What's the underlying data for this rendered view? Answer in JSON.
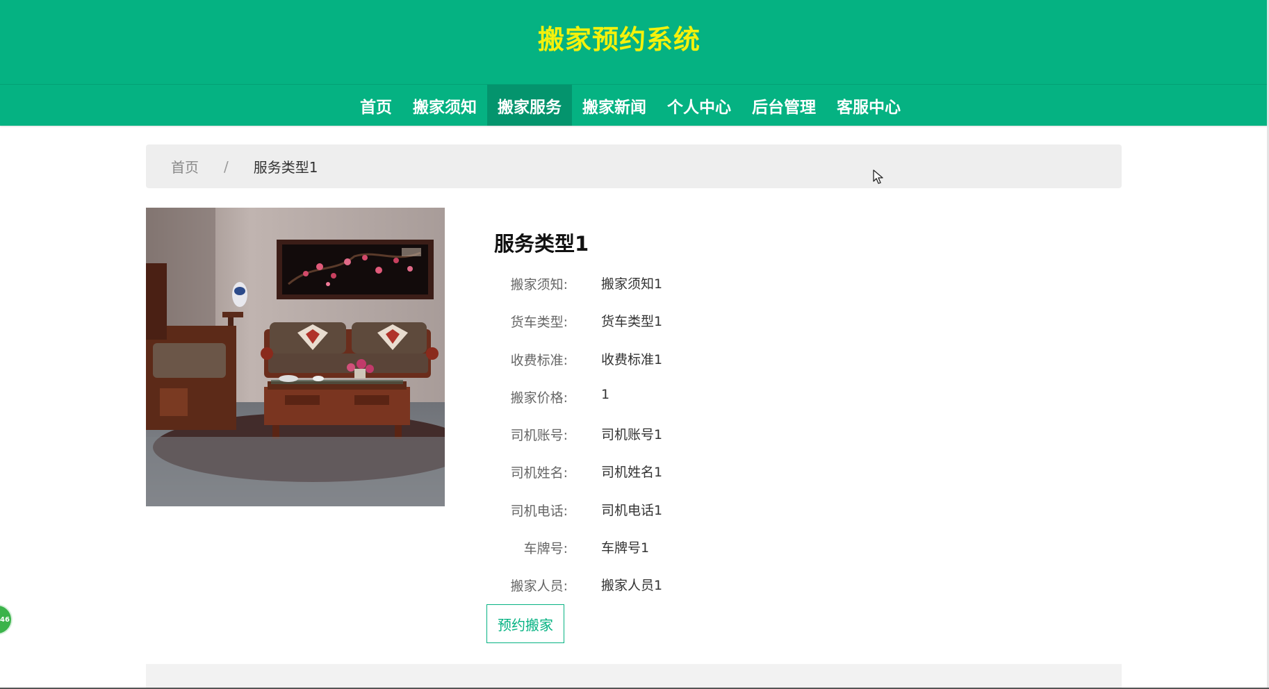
{
  "site": {
    "title": "搬家预约系统"
  },
  "nav": {
    "items": [
      {
        "label": "首页"
      },
      {
        "label": "搬家须知"
      },
      {
        "label": "搬家服务"
      },
      {
        "label": "搬家新闻"
      },
      {
        "label": "个人中心"
      },
      {
        "label": "后台管理"
      },
      {
        "label": "客服中心"
      }
    ],
    "active": "搬家服务"
  },
  "breadcrumb": {
    "home": "首页",
    "separator": "/",
    "current": "服务类型1"
  },
  "detail": {
    "title": "服务类型1",
    "rows": [
      {
        "label": "搬家须知:",
        "value": "搬家须知1"
      },
      {
        "label": "货车类型:",
        "value": "货车类型1"
      },
      {
        "label": "收费标准:",
        "value": "收费标准1"
      },
      {
        "label": "搬家价格:",
        "value": "1"
      },
      {
        "label": "司机账号:",
        "value": "司机账号1"
      },
      {
        "label": "司机姓名:",
        "value": "司机姓名1"
      },
      {
        "label": "司机电话:",
        "value": "司机电话1"
      },
      {
        "label": "车牌号:",
        "value": "车牌号1"
      },
      {
        "label": "搬家人员:",
        "value": "搬家人员1"
      }
    ],
    "book_button": "预约搬家"
  },
  "side_badge": {
    "text": "46"
  },
  "colors": {
    "brand": "#05b282",
    "title": "#f4f10c",
    "nav_active": "#04946d"
  }
}
